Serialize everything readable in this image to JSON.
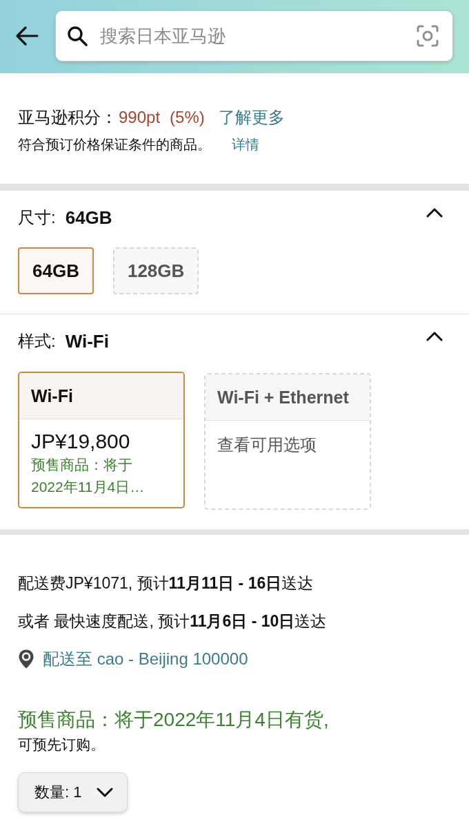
{
  "header": {
    "search": {
      "placeholder": "搜索日本亚马逊"
    }
  },
  "points": {
    "label": "亚马逊积分：",
    "value": "990pt",
    "rate": "(5%)",
    "link": "了解更多"
  },
  "price_guarantee": {
    "text": "符合预订价格保证条件的商品。",
    "link": "详情"
  },
  "variations": [
    {
      "kind": "buttons",
      "label": "尺寸:",
      "value": "64GB",
      "expanded": true,
      "options": [
        {
          "label": "64GB",
          "selected": true
        },
        {
          "label": "128GB",
          "selected": false
        }
      ]
    },
    {
      "kind": "cards",
      "label": "样式:",
      "value": "Wi-Fi",
      "expanded": true,
      "options": [
        {
          "label": "Wi-Fi",
          "selected": true,
          "price": "JP¥19,800",
          "availability": [
            "预售商品：将于",
            "2022年11月4日…"
          ]
        },
        {
          "label": "Wi-Fi + Ethernet",
          "selected": false,
          "hint": "查看可用选项"
        }
      ]
    }
  ],
  "delivery": {
    "estimates": [
      "配送费JP¥1071, 预计**11月11日 - 16日**送达",
      "或者 最快速度配送, 预计**11月6日 - 10日**送达"
    ],
    "address_link": "配送至 cao - Beijing 100000"
  },
  "availability": {
    "status": "预售商品：将于2022年11月4日有货,",
    "note": "可预先订购。"
  },
  "quantity": {
    "label": "数量:",
    "value": "1"
  }
}
